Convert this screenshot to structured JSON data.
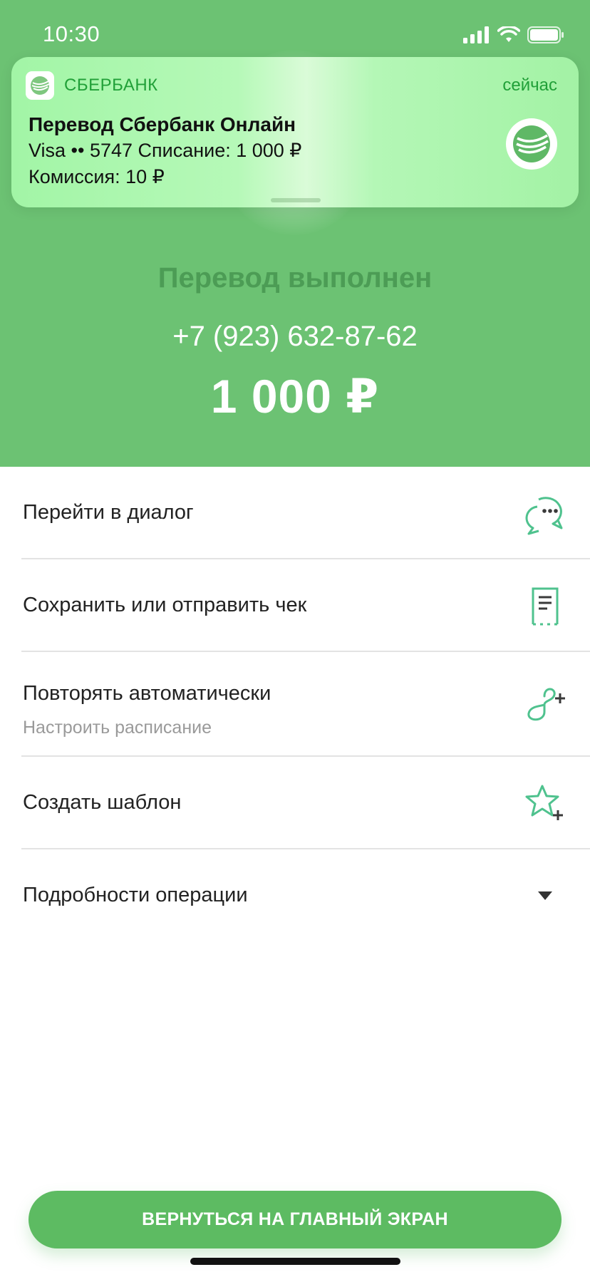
{
  "status_bar": {
    "time": "10:30"
  },
  "notification": {
    "app_name": "СБЕРБАНК",
    "time": "сейчас",
    "title": "Перевод Сбербанк Онлайн",
    "line1": "Visa •• 5747 Списание: 1 000 ₽",
    "line2": "Комиссия: 10 ₽"
  },
  "hero": {
    "title": "Перевод выполнен",
    "phone": "+7 (923) 632-87-62",
    "amount": "1 000 ₽"
  },
  "actions": [
    {
      "label": "Перейти в диалог",
      "icon": "chat-bubbles-icon"
    },
    {
      "label": "Сохранить или отправить чек",
      "icon": "receipt-icon"
    },
    {
      "label": "Повторять автоматически",
      "sublabel": "Настроить расписание",
      "icon": "repeat-plus-icon"
    },
    {
      "label": "Создать шаблон",
      "icon": "star-plus-icon"
    },
    {
      "label": "Подробности операции",
      "icon": "chevron-down-icon"
    }
  ],
  "main_button": {
    "label": "ВЕРНУТЬСЯ НА ГЛАВНЫЙ ЭКРАН"
  },
  "colors": {
    "hero_green": "#6cc273",
    "brand_green": "#21a038",
    "button_green": "#5dbb62",
    "icon_teal": "#4fc28e"
  }
}
